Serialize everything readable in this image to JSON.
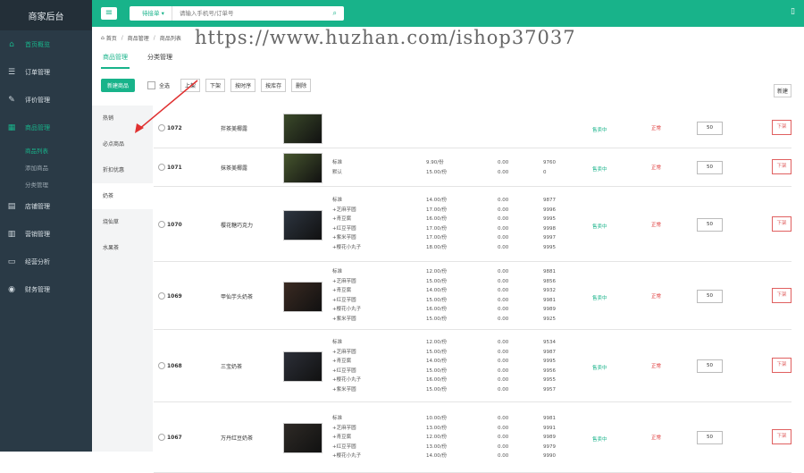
{
  "sidebar": {
    "brand": "商家后台",
    "items": [
      {
        "label": "首页概览",
        "icon": "home-icon",
        "glyph": "⌂"
      },
      {
        "label": "订单管理",
        "icon": "order-icon",
        "glyph": "☰"
      },
      {
        "label": "评价管理",
        "icon": "edit-icon",
        "glyph": "✎"
      },
      {
        "label": "商品管理",
        "icon": "goods-icon",
        "glyph": "▦"
      },
      {
        "label": "店铺管理",
        "icon": "shop-icon",
        "glyph": "▤"
      },
      {
        "label": "营销管理",
        "icon": "chart-icon",
        "glyph": "▥"
      },
      {
        "label": "经营分析",
        "icon": "monitor-icon",
        "glyph": "▭"
      },
      {
        "label": "财务管理",
        "icon": "finance-icon",
        "glyph": "◉"
      }
    ],
    "sub_items": [
      "商品列表",
      "添加商品",
      "分类管理"
    ]
  },
  "topbar": {
    "menu_glyph": "≡",
    "search_select": "待接单 ▾",
    "search_placeholder": "请输入手机号/订单号",
    "search_glyph": "⌕",
    "phone_glyph": "▯"
  },
  "breadcrumb": {
    "home_glyph": "⌂",
    "items": [
      "首页",
      "商品管理",
      "商品列表"
    ]
  },
  "watermark": "https://www.huzhan.com/ishop37037",
  "tabs": [
    "商品管理",
    "分类管理"
  ],
  "toolbar": {
    "new_button": "新建商品",
    "select_all": "全选",
    "buttons": [
      "上架",
      "下架",
      "按时序",
      "按库存",
      "删除"
    ],
    "right_button": "新建"
  },
  "categories": [
    "热销",
    "必点商品",
    "折扣优惠",
    "奶茶",
    "烧仙草",
    "水果茶"
  ],
  "products": [
    {
      "id": "1072",
      "name": "拌茶美椰露",
      "specs": [],
      "prices": [],
      "zeros": [],
      "stock": [],
      "status": "售卖中",
      "state": "正常",
      "sort": "50",
      "action": "下架"
    },
    {
      "id": "1071",
      "name": "抹茶美椰露",
      "specs": [
        "标准",
        "默认"
      ],
      "prices": [
        "9.90/份",
        "15.00/份"
      ],
      "zeros": [
        "0.00",
        "0.00"
      ],
      "stock": [
        "9760",
        "0"
      ],
      "status": "售卖中",
      "state": "正常",
      "sort": "50",
      "action": "下架"
    },
    {
      "id": "1070",
      "name": "樱花糖巧克力",
      "specs": [
        "标准",
        "+芝麻芋圆",
        "+青豆腐",
        "+红豆芋圆",
        "+紫米芋圆",
        "+樱花小丸子"
      ],
      "prices": [
        "14.00/份",
        "17.00/份",
        "16.00/份",
        "17.00/份",
        "17.00/份",
        "18.00/份"
      ],
      "zeros": [
        "0.00",
        "0.00",
        "0.00",
        "0.00",
        "0.00",
        "0.00"
      ],
      "stock": [
        "9877",
        "9996",
        "9995",
        "9998",
        "9997",
        "9995"
      ],
      "status": "售卖中",
      "state": "正常",
      "sort": "50",
      "action": "下架"
    },
    {
      "id": "1069",
      "name": "甲仙芋头奶茶",
      "specs": [
        "标准",
        "+芝麻芋圆",
        "+青豆腐",
        "+红豆芋圆",
        "+樱花小丸子",
        "+紫米芋圆"
      ],
      "prices": [
        "12.00/份",
        "15.00/份",
        "14.00/份",
        "15.00/份",
        "16.00/份",
        "15.00/份"
      ],
      "zeros": [
        "0.00",
        "0.00",
        "0.00",
        "0.00",
        "0.00",
        "0.00"
      ],
      "stock": [
        "9881",
        "9856",
        "9932",
        "9981",
        "9989",
        "9925"
      ],
      "status": "售卖中",
      "state": "正常",
      "sort": "50",
      "action": "下架"
    },
    {
      "id": "1068",
      "name": "三宝奶茶",
      "specs": [
        "标准",
        "+芝麻芋圆",
        "+青豆腐",
        "+红豆芋圆",
        "+樱花小丸子",
        "+紫米芋圆"
      ],
      "prices": [
        "12.00/份",
        "15.00/份",
        "14.00/份",
        "15.00/份",
        "16.00/份",
        "15.00/份"
      ],
      "zeros": [
        "0.00",
        "0.00",
        "0.00",
        "0.00",
        "0.00",
        "0.00"
      ],
      "stock": [
        "9534",
        "9987",
        "9995",
        "9956",
        "9955",
        "9957"
      ],
      "status": "售卖中",
      "state": "正常",
      "sort": "50",
      "action": "下架"
    },
    {
      "id": "1067",
      "name": "万丹红豆奶茶",
      "specs": [
        "标准",
        "+芝麻芋圆",
        "+青豆腐",
        "+红豆芋圆",
        "+樱花小丸子"
      ],
      "prices": [
        "10.00/份",
        "13.00/份",
        "12.00/份",
        "13.00/份",
        "14.00/份"
      ],
      "zeros": [
        "0.00",
        "0.00",
        "0.00",
        "0.00",
        "0.00"
      ],
      "stock": [
        "9981",
        "9991",
        "9989",
        "9979",
        "9990"
      ],
      "status": "售卖中",
      "state": "正常",
      "sort": "50",
      "action": "下架"
    }
  ],
  "colors": {
    "accent": "#18b38a",
    "sidebar": "#2a3a46",
    "danger": "#d33"
  }
}
